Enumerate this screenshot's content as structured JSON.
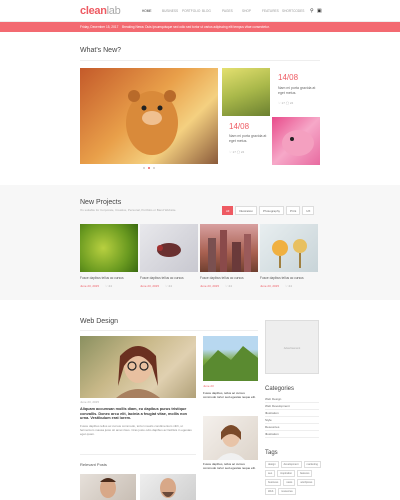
{
  "header": {
    "logo_main": "clean",
    "logo_accent": "lab",
    "nav": [
      "Home",
      "Business",
      "Portfolio",
      "Blog",
      "Pages",
      "Shop",
      "Features",
      "Shortcodes"
    ]
  },
  "banner": {
    "date": "Friday, December 15, 2017",
    "text": "Breaking News: Duis Ipsumquisque sed odio sed tortor ut varius adipiscing elit tempus vitae consectetur."
  },
  "whatsnew": {
    "title": "What's New?",
    "cards": [
      {
        "date": "14/08",
        "text": "Nam mi porta gravida at eget metus.",
        "meta": "♡ 17  ◯ 24"
      },
      {
        "date": "14/08",
        "text": "Nam mi porta gravida at eget metus.",
        "meta": "♡ 17  ◯ 24"
      }
    ]
  },
  "projects": {
    "title": "New Projects",
    "subtitle": "It's suitable for Corporate, Creative, Personal, Portfolio or Band Website.",
    "filters": [
      "All",
      "Illustration",
      "Photography",
      "Print",
      "UX"
    ],
    "items": [
      {
        "caption": "Fusce dapibus tellus ac cursus",
        "date": "June 23, 2015",
        "meta": "♡ 24"
      },
      {
        "caption": "Fusce dapibus tellus ac cursus",
        "date": "June 23, 2015",
        "meta": "♡ 24"
      },
      {
        "caption": "Fusce dapibus tellus ac cursus",
        "date": "June 23, 2015",
        "meta": "♡ 24"
      },
      {
        "caption": "Fusce dapibus tellus ac cursus",
        "date": "June 23, 2015",
        "meta": "♡ 24"
      }
    ]
  },
  "webdesign": {
    "title": "Web Design",
    "main_meta": "June 23, 2015",
    "main_title": "Aliquam accumsan mollis diam, eu dapibus purus tristique convallis. Donec arcu elit, lacinia a feugiat vitae, mollis non urna. Vestibulum erat lorem.",
    "main_text": "Fusce dapibus tellus ac cursus commodo, tortor mauris condimentum nibh, ut fermentum massa justo sit amet risus. Cras justo odio dapibus ac facilisis in egestas eget quam.",
    "side": [
      {
        "date": "June 23",
        "title": "Fusce dapibus, tellus ac cursus commodo tortor sed egestas neque elit."
      },
      {
        "title": "Fusce dapibus, tellus ac cursus commodo tortor sed egestas neque elit."
      }
    ],
    "related": "Relevant Posts"
  },
  "sidebar": {
    "ad": "Advertisement",
    "categories_title": "Categories",
    "categories": [
      "Web Design",
      "Web Development",
      "Illustration",
      "Style",
      "Resources",
      "Illustration"
    ],
    "tags_title": "Tags",
    "tags": [
      "design",
      "development",
      "marketing",
      "seo",
      "inspiration",
      "features",
      "business",
      "news",
      "wordpress",
      "Web",
      "resources"
    ]
  }
}
